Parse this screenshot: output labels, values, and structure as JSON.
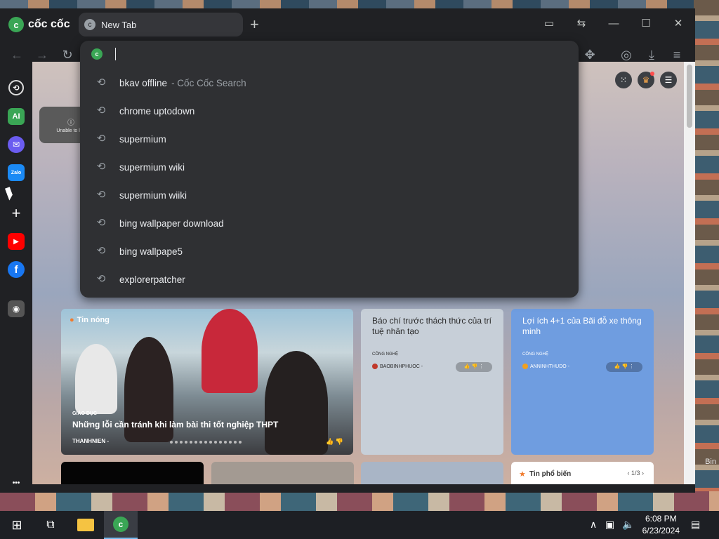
{
  "browser": {
    "brand": "cốc cốc",
    "tab_title": "New Tab",
    "newtab_glyph": "+",
    "omnibox_value": ""
  },
  "omnibox": {
    "suggestions": [
      {
        "text": "bkav offline",
        "suffix": "- Cốc Cốc Search"
      },
      {
        "text": "chrome uptodown",
        "suffix": ""
      },
      {
        "text": "supermium",
        "suffix": ""
      },
      {
        "text": "supermium wiki",
        "suffix": ""
      },
      {
        "text": "supermium wiiki",
        "suffix": ""
      },
      {
        "text": "bing wallpaper download",
        "suffix": ""
      },
      {
        "text": "bing wallpape5",
        "suffix": ""
      },
      {
        "text": "explorerpatcher",
        "suffix": ""
      }
    ]
  },
  "sidebar": {
    "items": [
      {
        "name": "history",
        "glyph": "⟲"
      },
      {
        "name": "ai",
        "glyph": "AI"
      },
      {
        "name": "messenger",
        "glyph": "✉"
      },
      {
        "name": "zalo",
        "glyph": "Zalo"
      },
      {
        "name": "add",
        "glyph": "+"
      },
      {
        "name": "youtube",
        "glyph": "▶"
      },
      {
        "name": "facebook",
        "glyph": "f"
      },
      {
        "name": "game",
        "glyph": "◉"
      },
      {
        "name": "more",
        "glyph": "•••"
      }
    ]
  },
  "newtab": {
    "unable_tile": "Unable to loa",
    "hot_news_label": "Tin nóng",
    "big_card": {
      "category": "GIÁO DỤC",
      "title": "Những lỗi cần tránh khi làm bài thi tốt nghiệp THPT",
      "source": "THANHNIEN -"
    },
    "card2": {
      "title": "Báo chí trước thách thức của trí tuệ nhân tạo",
      "category": "CÔNG NGHỆ",
      "source": "BAOBINHPHUOC -"
    },
    "card3": {
      "title": "Lợi ích 4+1 của Bãi đỗ xe thông minh",
      "category": "CÔNG NGHỆ",
      "source": "ANNINHTHUDO -"
    },
    "popular_label": "Tin phổ biến",
    "popular_page": "1/3"
  },
  "desktop": {
    "recycle_bin_label": "Bin"
  },
  "taskbar": {
    "time": "6:08 PM",
    "date": "6/23/2024"
  },
  "colors": {
    "accent_green": "#3aa655",
    "hot_orange": "#f07b2d",
    "card3_blue": "#6f9de0",
    "card2_gray": "#c7cfd8"
  }
}
